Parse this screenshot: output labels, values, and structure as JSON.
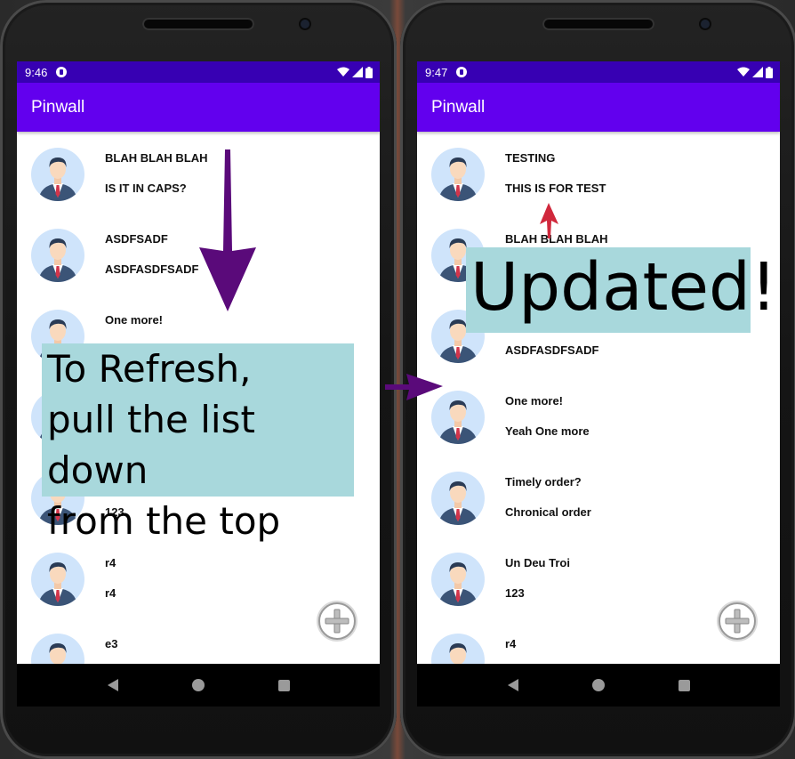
{
  "left_phone": {
    "status_time": "9:46",
    "app_title": "Pinwall",
    "items": [
      {
        "title": "BLAH BLAH BLAH",
        "body": "IS IT IN CAPS?"
      },
      {
        "title": "ASDFSADF",
        "body": "ASDFASDFSADF"
      },
      {
        "title": "One more!",
        "body": ""
      },
      {
        "title": "",
        "body": ""
      },
      {
        "title": "",
        "body": "123"
      },
      {
        "title": "r4",
        "body": "r4"
      },
      {
        "title": "e3",
        "body": ""
      }
    ]
  },
  "right_phone": {
    "status_time": "9:47",
    "app_title": "Pinwall",
    "items": [
      {
        "title": "TESTING",
        "body": "THIS IS FOR TEST"
      },
      {
        "title": "BLAH BLAH BLAH",
        "body": ""
      },
      {
        "title": "",
        "body": "ASDFASDFSADF"
      },
      {
        "title": "One more!",
        "body": "Yeah One more"
      },
      {
        "title": "Timely order?",
        "body": "Chronical order"
      },
      {
        "title": "Un Deu Troi",
        "body": "123"
      },
      {
        "title": "r4",
        "body": ""
      }
    ]
  },
  "annotations": {
    "refresh_line1": "To Refresh,",
    "refresh_line2": "pull the list down",
    "refresh_line3": "from the top",
    "updated": "Updated!"
  },
  "icons": {
    "avatar": "businessman-avatar-icon",
    "fab": "add-icon",
    "wifi": "wifi-icon",
    "signal": "signal-icon",
    "battery": "battery-icon",
    "back": "back-icon",
    "home": "home-icon",
    "recents": "recents-icon"
  },
  "colors": {
    "status_bar": "#3700b3",
    "app_bar": "#6200ee",
    "callout": "#a8d8dc",
    "arrow_purple": "#5a0a7a",
    "arrow_red": "#d0283c"
  }
}
